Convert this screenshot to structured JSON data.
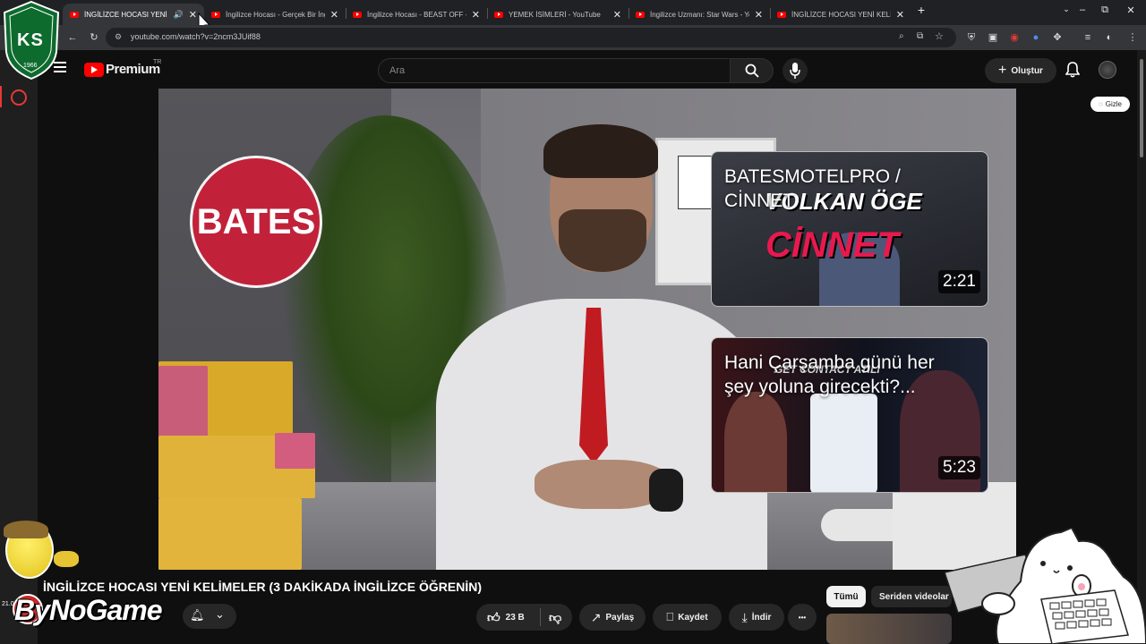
{
  "browser": {
    "tabs": [
      {
        "title": "İNGİLİZCE HOCASI YENİ KE",
        "active": true,
        "audio": true
      },
      {
        "title": "İngilizce Hocası - Gerçek Bir İng"
      },
      {
        "title": "İngilizce Hocası - BEAST OFF - Y"
      },
      {
        "title": "YEMEK İSİMLERİ - YouTube"
      },
      {
        "title": "İngilizce Uzmanı: Star Wars - Yo"
      },
      {
        "title": "İNGİLİZCE HOCASI YENİ KELİM"
      }
    ],
    "new_tab_icon": "+",
    "url": "youtube.com/watch?v=2ncm3JUif88",
    "window_controls": {
      "minimize": "–",
      "maximize": "⧉",
      "close": "✕"
    }
  },
  "youtube": {
    "logo_text": "Premium",
    "logo_region": "TR",
    "search_placeholder": "Ara",
    "create_label": "Oluştur",
    "hide_label": "Gizle"
  },
  "video": {
    "overlay_logo_text": "BATES",
    "end_cards": [
      {
        "caption": "BATESMOTELPRO / CİNNET",
        "art_text_1": "VOLKAN ÖGE",
        "art_text_2": "CİNNET",
        "duration": "2:21"
      },
      {
        "caption": "Hani Çarşamba günü her şey yoluna girecekti?...",
        "art_text_1": "GET CONTACT ATILI",
        "duration": "5:23"
      }
    ],
    "title": "İNGİLİZCE HOCASI YENİ KELİMELER (3 DAKİKADA İNGİLİZCE ÖĞRENİN)"
  },
  "actions": {
    "like_count": "23 B",
    "share_label": "Paylaş",
    "save_label": "Kaydet",
    "download_label": "İndir",
    "more_label": "•••"
  },
  "chips": [
    {
      "label": "Tümü",
      "selected": true
    },
    {
      "label": "Seriden videolar",
      "selected": false
    }
  ],
  "overlays": {
    "streamer_brand": "ByNoGame",
    "team_logo_letters": "KS",
    "team_logo_year": "1966",
    "side_counter": "21.0"
  },
  "colors": {
    "yt_red": "#ff0000",
    "bates_red": "#c1223a",
    "background": "#0f0f0f",
    "pill_bg": "#272727"
  }
}
